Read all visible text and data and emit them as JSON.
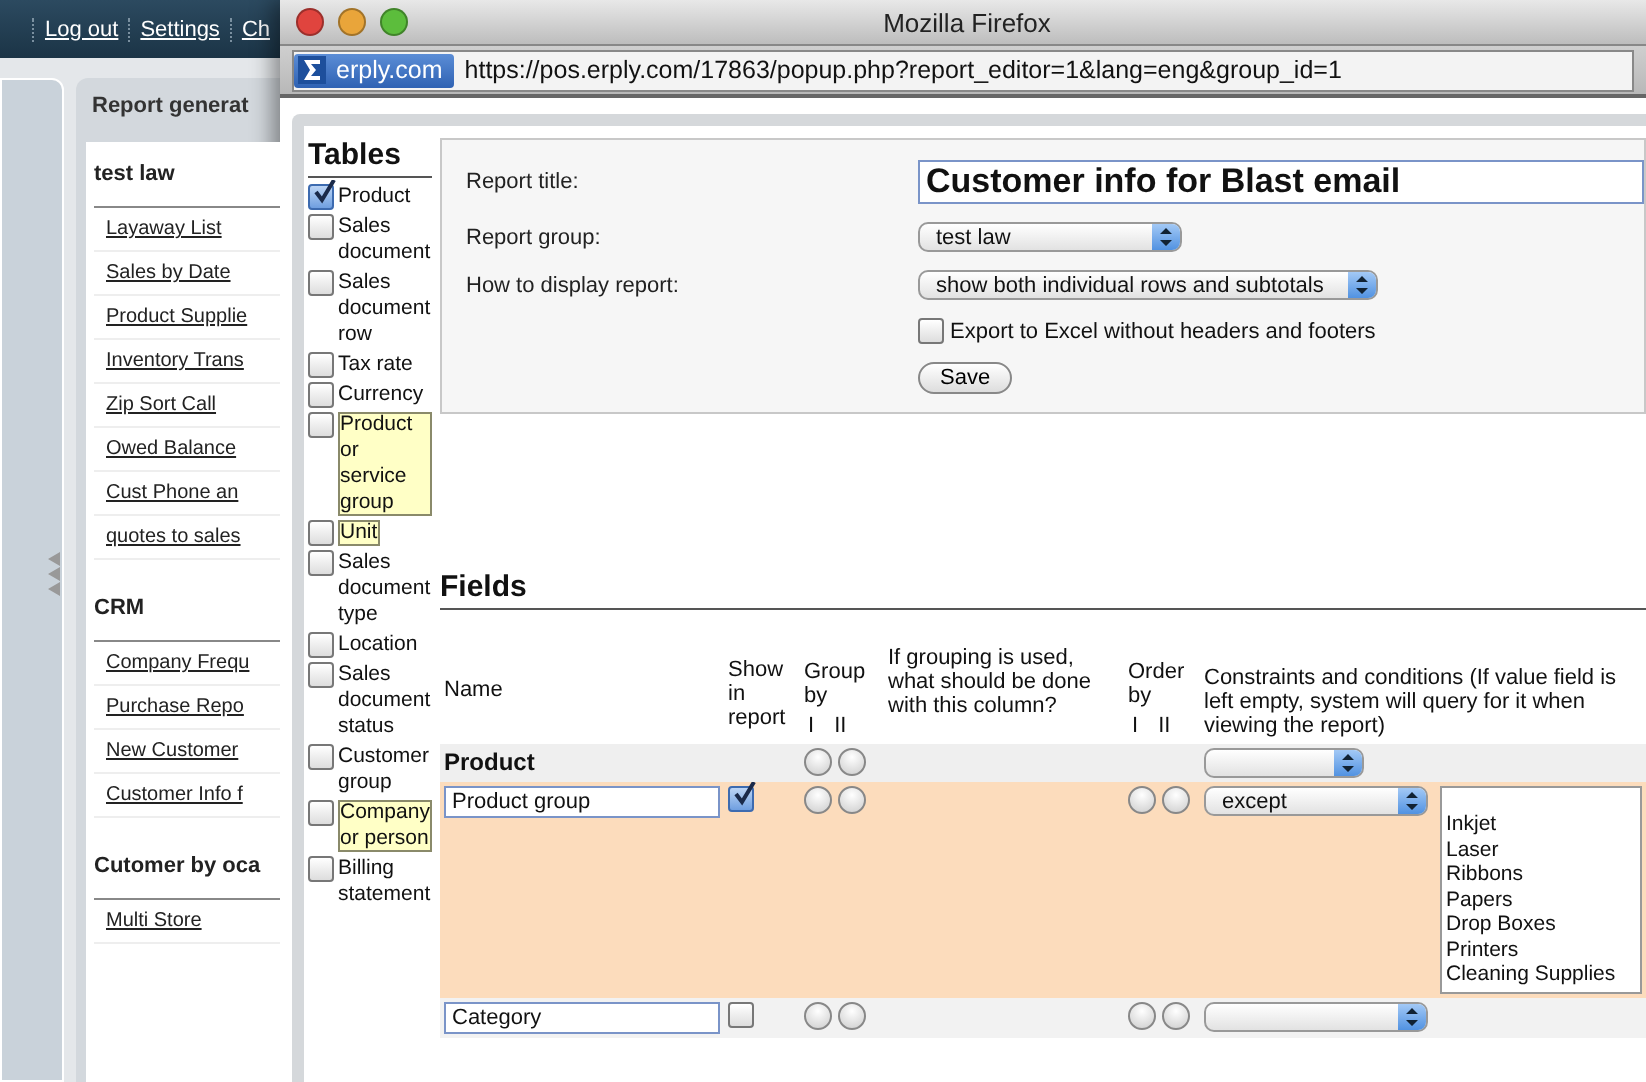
{
  "background_app": {
    "top_links": [
      "Log out",
      "Settings",
      "Ch"
    ],
    "panel_title": "Report generat",
    "groups": [
      {
        "title": "test law",
        "links": [
          "Layaway List",
          "Sales by Date",
          "Product Supplie",
          "Inventory Trans",
          "Zip Sort Call",
          "Owed Balance",
          "Cust Phone an",
          "quotes to sales"
        ]
      },
      {
        "title": "CRM",
        "links": [
          "Company Frequ",
          "Purchase Repo",
          "New Customer",
          "Customer Info f"
        ]
      },
      {
        "title": "Cutomer by oca",
        "links": [
          "Multi Store"
        ]
      }
    ]
  },
  "browser": {
    "title": "Mozilla Firefox",
    "site_badge": "erply.com",
    "url": "https://pos.erply.com/17863/popup.php?report_editor=1&lang=eng&group_id=1"
  },
  "tables": {
    "heading": "Tables",
    "items": [
      {
        "label": "Product",
        "checked": true,
        "highlighted": false
      },
      {
        "label": "Sales document",
        "checked": false,
        "highlighted": false
      },
      {
        "label": "Sales document row",
        "checked": false,
        "highlighted": false
      },
      {
        "label": "Tax rate",
        "checked": false,
        "highlighted": false
      },
      {
        "label": "Currency",
        "checked": false,
        "highlighted": false
      },
      {
        "label": "Product or service group",
        "checked": false,
        "highlighted": true
      },
      {
        "label": "Unit",
        "checked": false,
        "highlighted": true
      },
      {
        "label": "Sales document type",
        "checked": false,
        "highlighted": false
      },
      {
        "label": "Location",
        "checked": false,
        "highlighted": false
      },
      {
        "label": "Sales document status",
        "checked": false,
        "highlighted": false
      },
      {
        "label": "Customer group",
        "checked": false,
        "highlighted": false
      },
      {
        "label": "Company or person",
        "checked": false,
        "highlighted": true
      },
      {
        "label": "Billing statement",
        "checked": false,
        "highlighted": false
      }
    ]
  },
  "settings": {
    "title_label": "Report title:",
    "title_value": "Customer info for Blast email",
    "group_label": "Report group:",
    "group_value": "test law",
    "display_label": "How to display report:",
    "display_value": "show both individual rows and subtotals",
    "export": {
      "label": "Export to Excel without headers and footers",
      "checked": false
    },
    "save": "Save"
  },
  "fields": {
    "heading": "Fields",
    "columns": {
      "name": "Name",
      "show": "Show in report",
      "group": "Group by",
      "grouping": "If grouping is used, what should be done with this column?",
      "order": "Order by",
      "constraints": "Constraints and conditions (If value field is left empty, system will query for it when viewing the report)"
    },
    "group_subs": [
      "I",
      "II"
    ],
    "order_subs": [
      "I",
      "II"
    ],
    "rows": [
      {
        "kind": "section",
        "name": "Product",
        "group_by": [
          {
            "selected": false
          },
          {
            "selected": false
          }
        ]
      },
      {
        "kind": "field",
        "name": "Product group",
        "show": true,
        "group_by": [
          {
            "selected": false
          },
          {
            "selected": false
          }
        ],
        "order_by": [
          {
            "selected": false
          },
          {
            "selected": false
          }
        ],
        "constraint": "except",
        "values": [
          "Inkjet",
          "Laser",
          "Ribbons",
          "Papers",
          "Drop Boxes",
          "Printers",
          "Cleaning Supplies"
        ]
      },
      {
        "kind": "field",
        "name": "Category",
        "show": false,
        "group_by": [
          {
            "selected": false
          },
          {
            "selected": false
          }
        ],
        "order_by": [
          {
            "selected": false
          },
          {
            "selected": false
          }
        ]
      }
    ]
  }
}
